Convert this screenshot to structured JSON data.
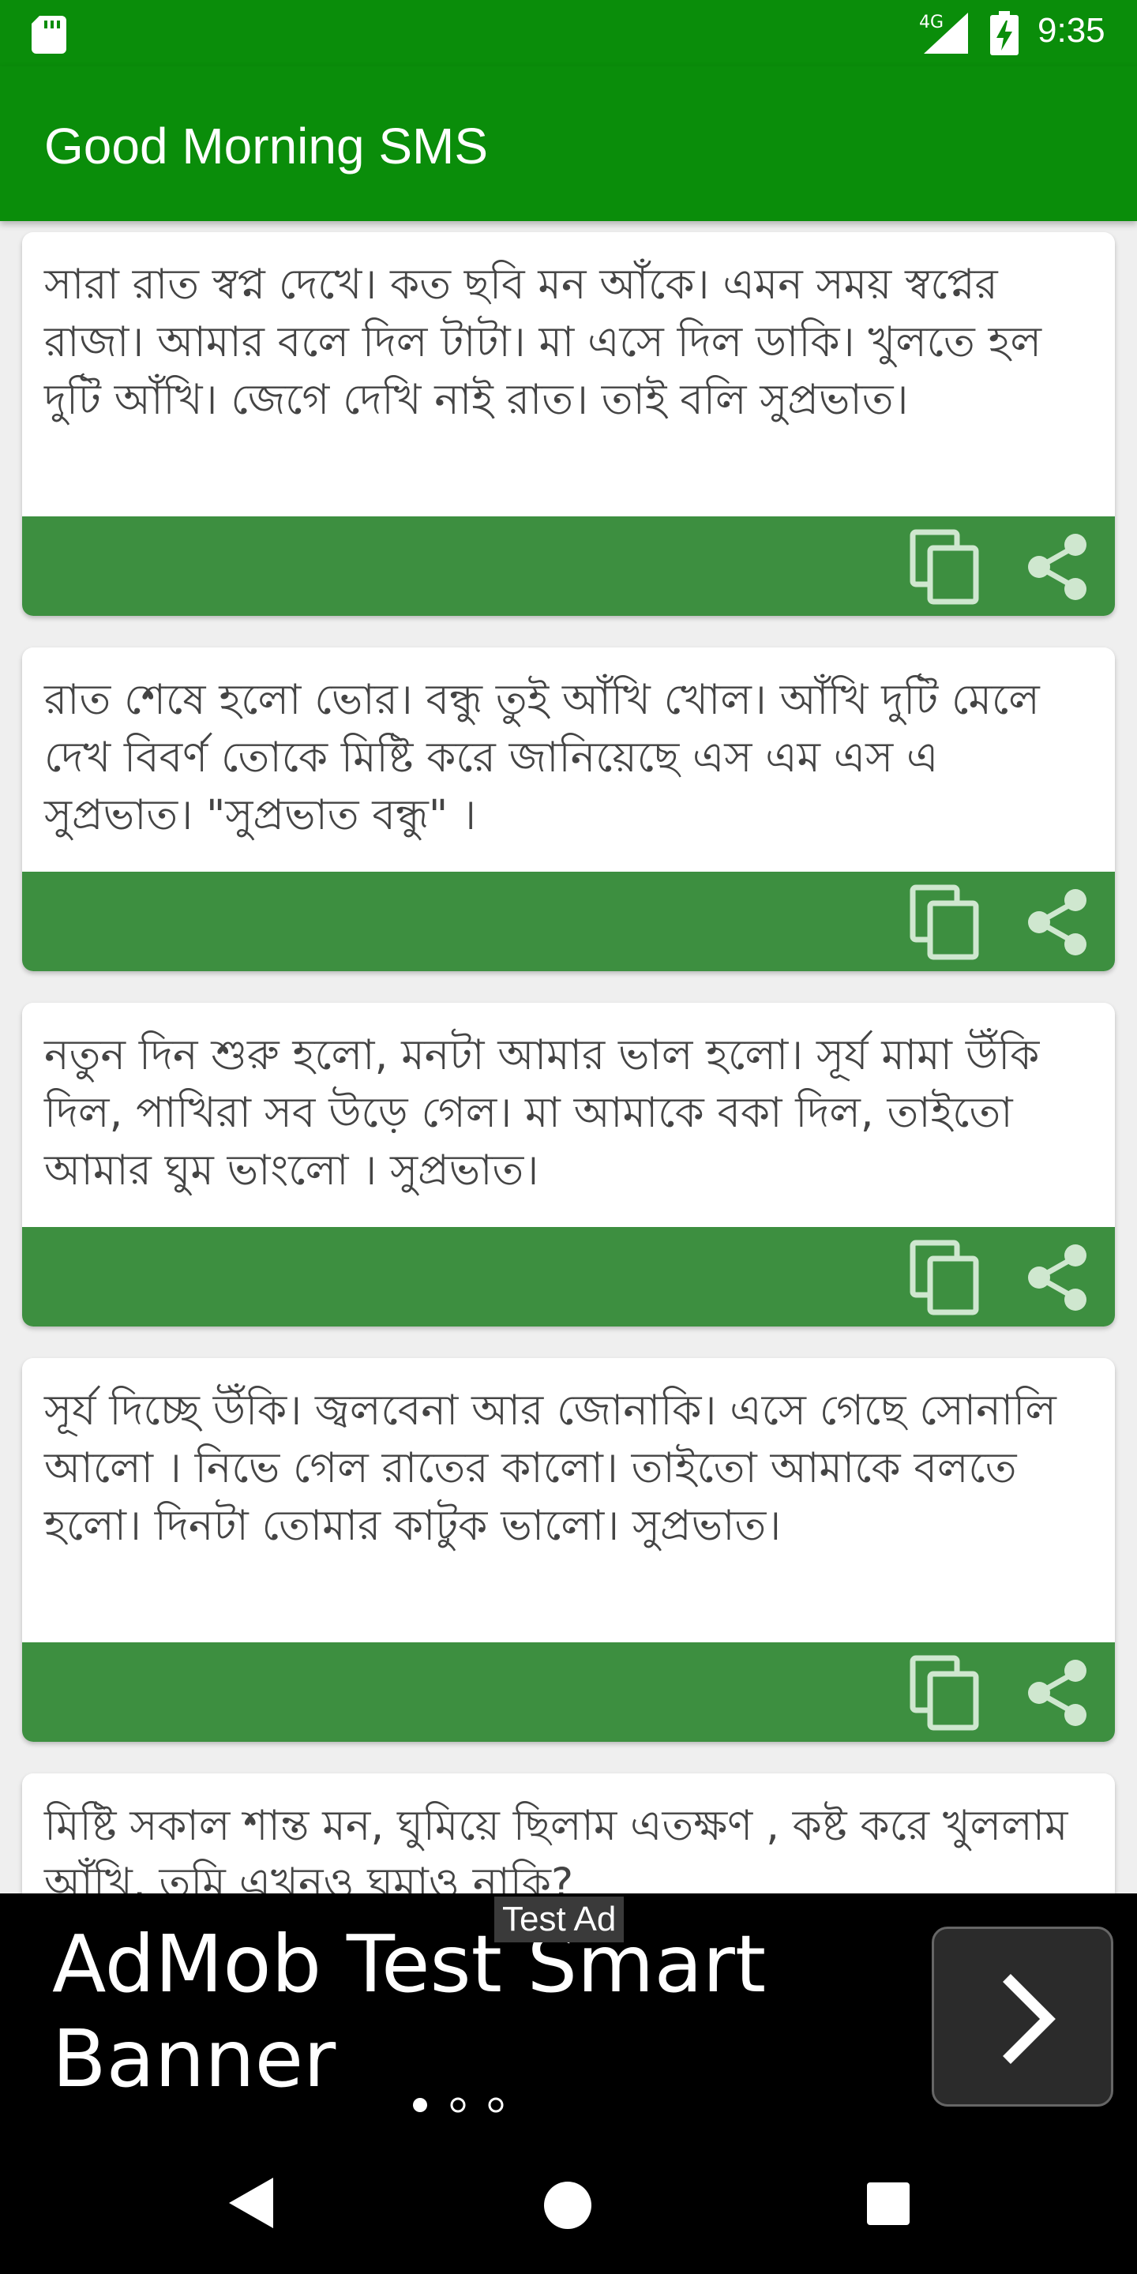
{
  "status_bar": {
    "network": "4G",
    "time": "9:35",
    "icons": [
      "sd-card-icon",
      "signal-icon",
      "battery-charging-icon"
    ]
  },
  "app_bar": {
    "title": "Good Morning SMS"
  },
  "messages": [
    {
      "text": "সারা রাত স্বপ্ন দেখে। কত ছবি মন আঁকে। এমন সময় স্বপ্নের রাজা। আমার বলে দিল টাটা। মা এসে দিল ডাকি। খুলতে হল দুটি আঁখি। জেগে দেখি নাই রাত। তাই বলি সুপ্রভাত।"
    },
    {
      "text": "রাত শেষে হলো ভোর। বন্ধু তুই আঁখি খোল। আঁখি দুটি মেলে দেখ বিবর্ণ তোকে মিষ্টি করে জানিয়েছে এস এম এস এ সুপ্রভাত। \"সুপ্রভাত বন্ধু\" ।"
    },
    {
      "text": "নতুন দিন শুরু হলো, মনটা আমার ভাল হলো। সূর্য মামা উঁকি দিল, পাখিরা সব উড়ে গেল। মা আমাকে বকা দিল, তাইতো আমার ঘুম ভাংলো । সুপ্রভাত।"
    },
    {
      "text": "সূর্য দিচ্ছে উঁকি। জ্বলবেনা আর জোনাকি। এসে গেছে সোনালি আলো । নিভে গেল রাতের কালো। তাইতো আমাকে বলতে হলো। দিনটা তোমার কাটুক ভালো। সুপ্রভাত।"
    },
    {
      "text": " মিষ্টি সকাল শান্ত মন, ঘুমিয়ে ছিলাম এতক্ষণ , কষ্ট করে খুললাম আঁখি, তুমি এখনও ঘুমাও নাকি?"
    }
  ],
  "ad": {
    "badge": "Test Ad",
    "headline": "AdMob Test Smart Banner",
    "pages": 3,
    "active_page": 1
  },
  "colors": {
    "status_bar": "#0a8d0a",
    "app_bar": "#0a8d0a",
    "card_action_bar": "#3d8f40",
    "card_text": "#444444",
    "background": "#efefef"
  }
}
